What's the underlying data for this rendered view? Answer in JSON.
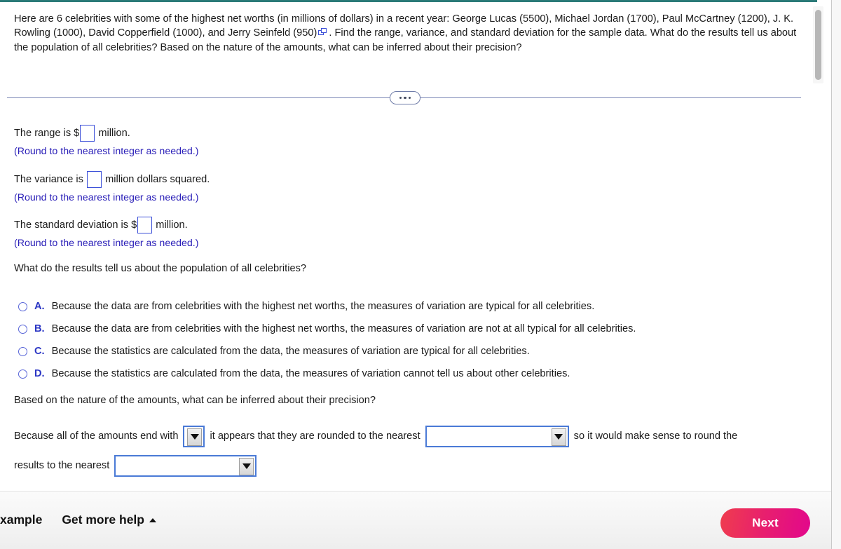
{
  "colors": {
    "top_rule": "#2b7a78",
    "hint_text": "#2b20b8",
    "choice_letter": "#2b36c4",
    "input_border": "#3b4fd8",
    "select_border": "#4a7ad6",
    "next_gradient_start": "#ef3d4e",
    "next_gradient_end": "#e2078c"
  },
  "statement": {
    "part1": "Here are 6 celebrities with some of the highest net worths (in millions of dollars) in a recent year: George Lucas (5500), Michael Jordan (1700), Paul McCartney (1200), J. K. Rowling (1000), David Copperfield (1000), and Jerry Seinfeld (950)",
    "icon": "popup-window-icon",
    "part2": ". Find the range, variance, and standard deviation for the sample data. What do the results tell us about the population of all celebrities? Based on the nature of the amounts, what can be inferred about their precision?"
  },
  "divider": {
    "ellipsis_label": "more-options-ellipsis"
  },
  "answers": [
    {
      "prefix": "The range is $",
      "suffix": " million.",
      "value": "",
      "hint": "(Round to the nearest integer as needed.)"
    },
    {
      "prefix": "The variance is ",
      "suffix": " million dollars squared.",
      "value": "",
      "hint": "(Round to the nearest integer as needed.)"
    },
    {
      "prefix": "The standard deviation is $",
      "suffix": " million.",
      "value": "",
      "hint": "(Round to the nearest integer as needed.)"
    }
  ],
  "mc": {
    "question": "What do the results tell us about the population of all celebrities?",
    "choices": [
      {
        "letter": "A.",
        "text": "Because the data are from celebrities with the highest net worths, the measures of variation are typical for all celebrities."
      },
      {
        "letter": "B.",
        "text": "Because the data are from celebrities with the highest net worths, the measures of variation are not at all typical for all celebrities."
      },
      {
        "letter": "C.",
        "text": "Because the statistics are calculated from the data, the measures of variation are typical for all celebrities."
      },
      {
        "letter": "D.",
        "text": "Because the statistics are calculated from the data, the measures of variation cannot tell us about other celebrities."
      }
    ],
    "selected": null
  },
  "precision": {
    "question": "Based on the nature of the amounts, what can be inferred about their precision?",
    "seg1": "Because all of the amounts end with",
    "select1_value": "",
    "seg2": "it appears that they are rounded to the nearest",
    "select2_value": "",
    "seg3": "so it would make sense to round the",
    "seg4": "results to the nearest",
    "select3_value": ""
  },
  "footer": {
    "view_example_label": "xample",
    "get_more_help_label": "Get more help",
    "get_more_help_icon": "caret-up-icon",
    "next_label": "Next"
  },
  "scrollbar": {
    "name": "vertical-scrollbar"
  }
}
